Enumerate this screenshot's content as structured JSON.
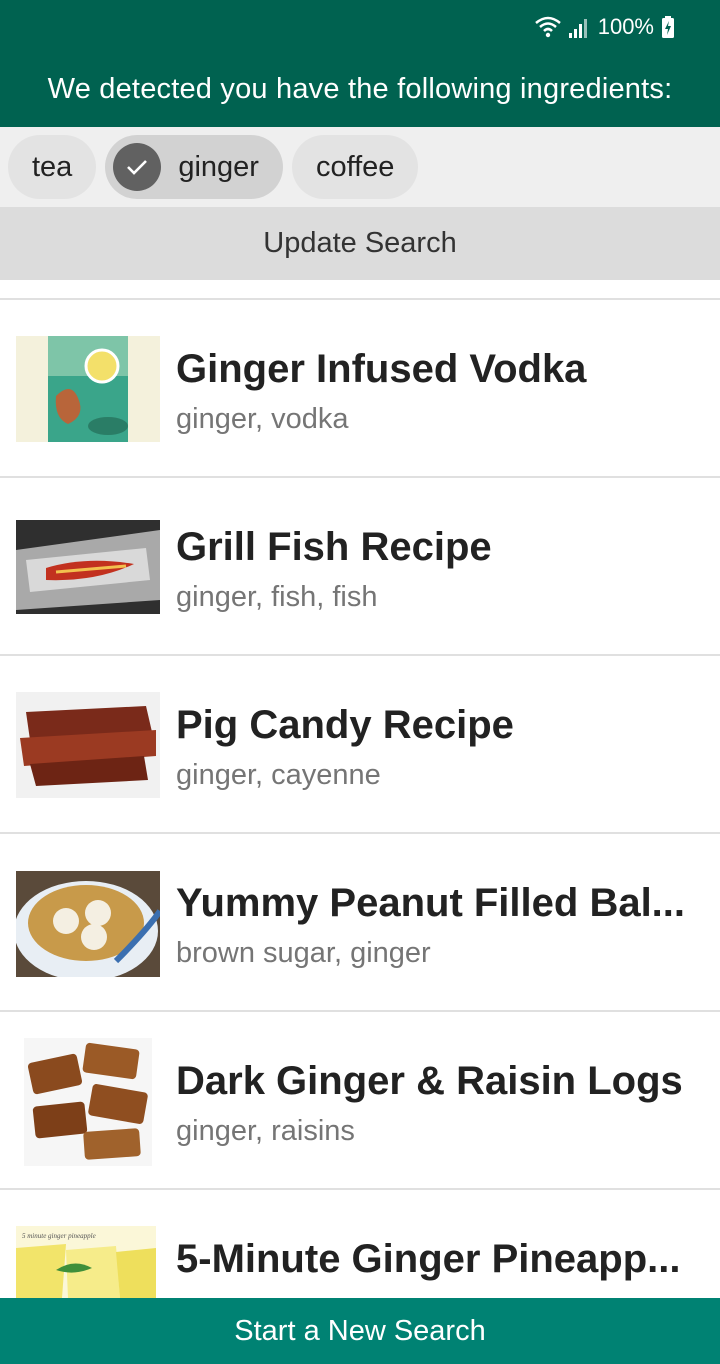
{
  "status": {
    "battery": "100%"
  },
  "header": {
    "title": "We detected you have the following ingredients:"
  },
  "chips": [
    {
      "label": "tea",
      "selected": false
    },
    {
      "label": "ginger",
      "selected": true
    },
    {
      "label": "coffee",
      "selected": false
    }
  ],
  "update_button": "Update Search",
  "recipes": [
    {
      "title": "Ginger Infused Vodka",
      "ingredients": "ginger, vodka"
    },
    {
      "title": "Grill Fish Recipe",
      "ingredients": "ginger, fish, fish"
    },
    {
      "title": "Pig Candy Recipe",
      "ingredients": "ginger, cayenne"
    },
    {
      "title": "Yummy Peanut Filled Bal...",
      "ingredients": "brown sugar, ginger"
    },
    {
      "title": "Dark Ginger & Raisin Logs",
      "ingredients": "ginger, raisins"
    },
    {
      "title": "5-Minute Ginger Pineapp...",
      "ingredients": ""
    }
  ],
  "thumbnail_caption": "5 minute ginger pineapple",
  "bottom_button": "Start a New Search",
  "colors": {
    "header": "#006250",
    "bottom_bar": "#008273",
    "chips_bar": "#efefef",
    "update_bar": "#dcdcdc"
  }
}
